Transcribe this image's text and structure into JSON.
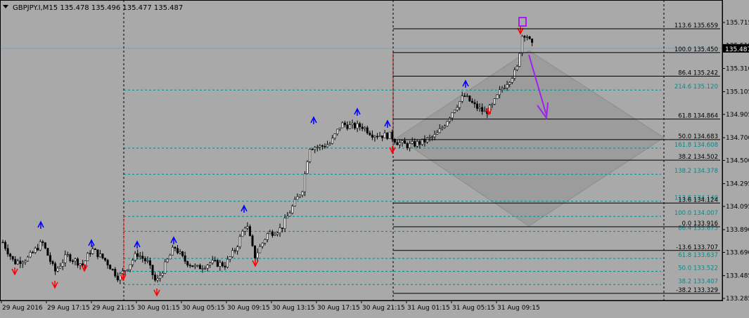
{
  "header": {
    "symbol_info": "GBPJPY.I,M15  135.478 135.496 135.477 135.487"
  },
  "price_axis": {
    "ticks": [
      "135.715",
      "135.515",
      "135.310",
      "135.105",
      "134.905",
      "134.700",
      "134.500",
      "134.295",
      "134.095",
      "133.890",
      "133.690",
      "133.485",
      "133.285"
    ],
    "current_price": "135.487"
  },
  "time_axis": {
    "labels": [
      "29 Aug 2016",
      "29 Aug 17:15",
      "29 Aug 21:15",
      "30 Aug 01:15",
      "30 Aug 05:15",
      "30 Aug 09:15",
      "30 Aug 13:15",
      "30 Aug 17:15",
      "30 Aug 21:15",
      "31 Aug 01:15",
      "31 Aug 05:15",
      "31 Aug 09:15"
    ]
  },
  "fib_black": [
    {
      "level": "113.6",
      "price": "135.659"
    },
    {
      "level": "100.0",
      "price": "135.450"
    },
    {
      "level": "86.4",
      "price": "135.242"
    },
    {
      "level": "61.8",
      "price": "134.864"
    },
    {
      "level": "50.0",
      "price": "134.683"
    },
    {
      "level": "38.2",
      "price": "134.502"
    },
    {
      "level": "13.6",
      "price": "134.124"
    },
    {
      "level": "0.0",
      "price": "133.916"
    },
    {
      "level": "-13.6",
      "price": "133.707"
    },
    {
      "level": "-38.2",
      "price": "133.329"
    }
  ],
  "fib_teal": [
    {
      "level": "214.6",
      "price": "135.120"
    },
    {
      "level": "161.8",
      "price": "134.608"
    },
    {
      "level": "138.2",
      "price": "134.378"
    },
    {
      "level": "113.6",
      "price": "134.140"
    },
    {
      "level": "100.0",
      "price": "134.007"
    },
    {
      "level": "86.4",
      "price": "133.875"
    },
    {
      "level": "61.8",
      "price": "133.637"
    },
    {
      "level": "50.0",
      "price": "133.522"
    },
    {
      "level": "38.2",
      "price": "133.407"
    }
  ],
  "colors": {
    "background": "#a9a9a9",
    "candle": "#000000",
    "grid_teal": "#008b8b",
    "fib_black": "#000000",
    "arrow_up": "#0000ff",
    "arrow_down": "#ff0000",
    "purple": "#a020f0",
    "price_tag_bg": "#000000"
  }
}
